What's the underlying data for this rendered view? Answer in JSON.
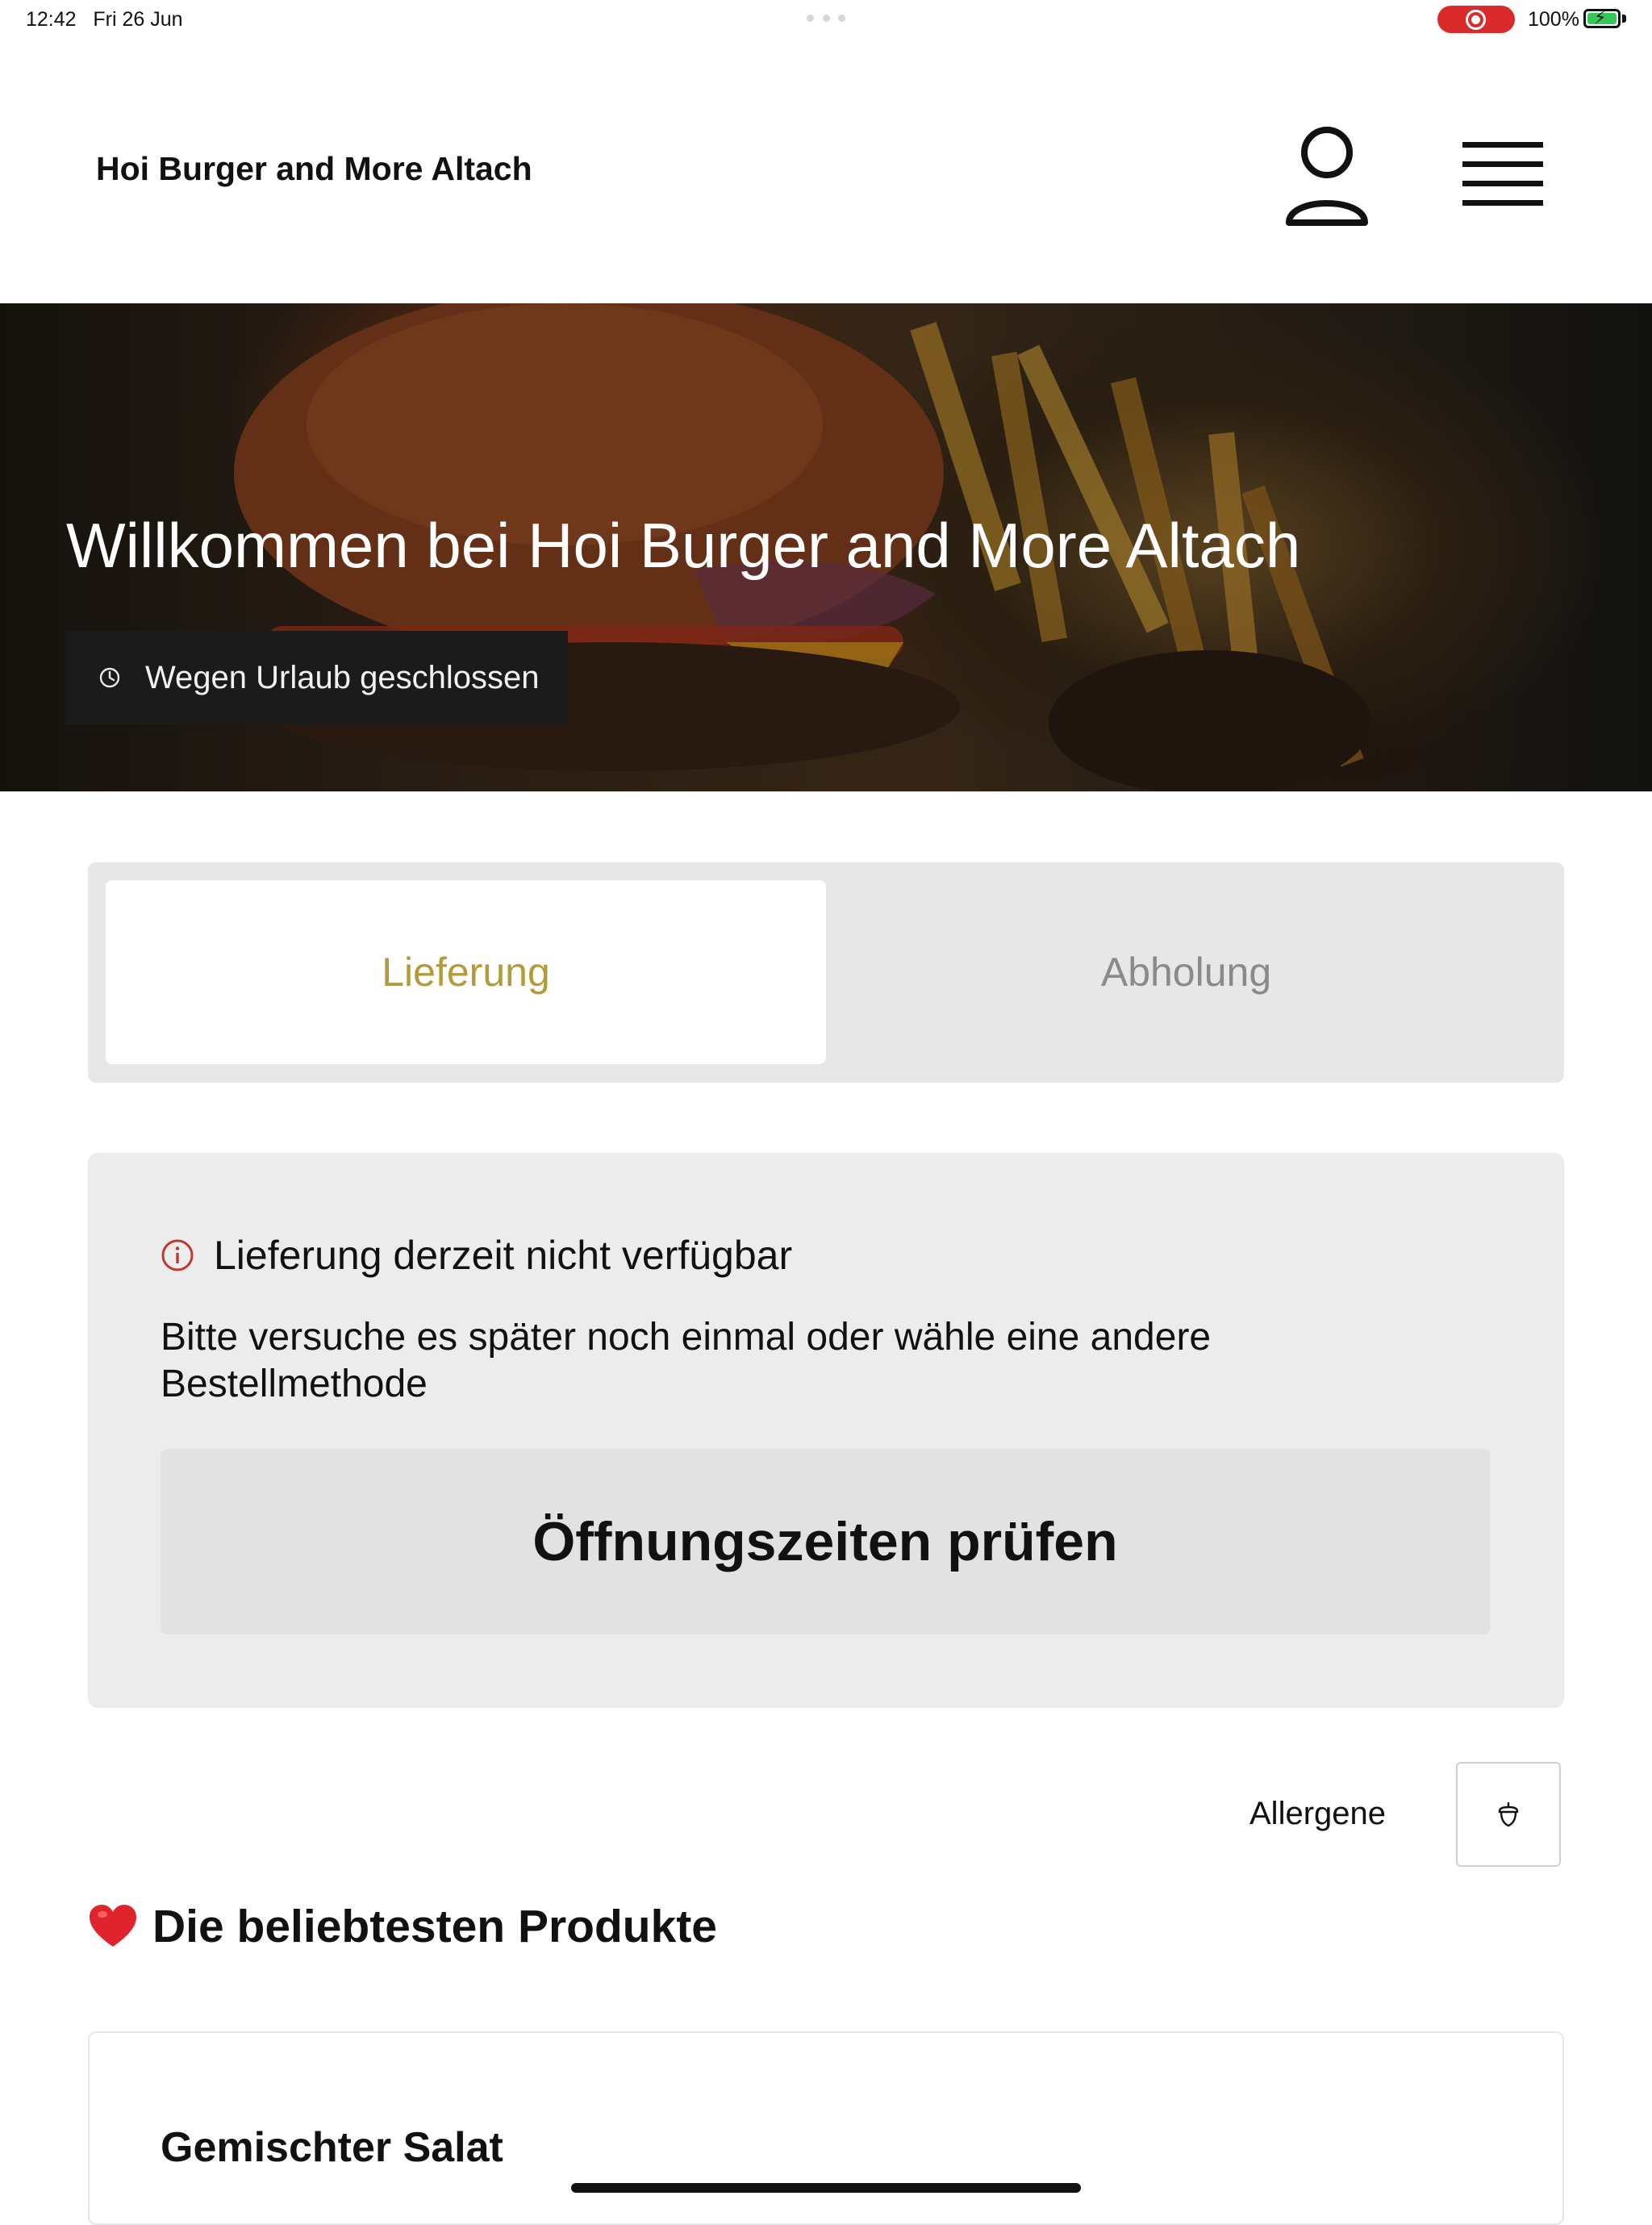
{
  "status_bar": {
    "time": "12:42",
    "date": "Fri 26 Jun",
    "battery": "100%",
    "recording_color": "#d92b2b"
  },
  "header": {
    "brand": "Hoi Burger and More Altach",
    "user_icon": "user-icon",
    "menu_icon": "hamburger-menu-icon"
  },
  "hero": {
    "title": "Willkommen bei Hoi Burger and More Altach",
    "status": "Wegen Urlaub geschlossen",
    "status_icon": "clock-icon"
  },
  "order_method": {
    "options": [
      "Lieferung",
      "Abholung"
    ],
    "selected": "Lieferung",
    "accent_color": "#b49a3a"
  },
  "notice": {
    "title": "Lieferung derzeit nicht verfügbar",
    "body": "Bitte versuche es später noch einmal oder wähle eine andere Bestellmethode",
    "button": "Öffnungszeiten prüfen",
    "icon": "info-icon",
    "icon_color": "#c0392b"
  },
  "allergens": {
    "label": "Allergene",
    "icon": "acorn-icon"
  },
  "popular": {
    "title": "Die beliebtesten Produkte",
    "icon": "heart-icon",
    "products": [
      {
        "name": "Gemischter Salat"
      }
    ]
  }
}
